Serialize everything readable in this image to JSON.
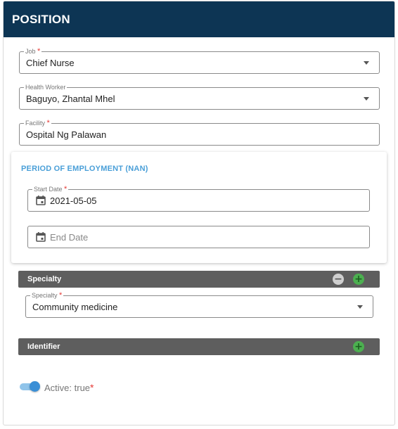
{
  "header": {
    "title": "POSITION"
  },
  "job": {
    "label": "Job",
    "required": "*",
    "value": "Chief Nurse"
  },
  "health_worker": {
    "label": "Health Worker",
    "value": "Baguyo, Zhantal Mhel"
  },
  "facility": {
    "label": "Facility",
    "required": "*",
    "value": "Ospital Ng Palawan"
  },
  "period": {
    "title": "PERIOD OF EMPLOYMENT (NAN)",
    "start_date": {
      "label": "Start Date",
      "required": "*",
      "value": "2021-05-05"
    },
    "end_date": {
      "placeholder": "End Date"
    }
  },
  "specialty_section": {
    "title": "Specialty",
    "field": {
      "label": "Specialty",
      "required": "*",
      "value": "Community medicine"
    }
  },
  "identifier_section": {
    "title": "Identifier"
  },
  "active": {
    "label": "Active: true",
    "required": "*",
    "checked": true
  },
  "colors": {
    "header_bg": "#0d3554",
    "section_bar_bg": "#5e5e5e",
    "accent_blue": "#4a9fd8",
    "add_green": "#4caf50",
    "required_red": "#e53935"
  },
  "icons": [
    "chevron-down-icon",
    "calendar-icon",
    "minus-circle-icon",
    "plus-circle-icon"
  ]
}
